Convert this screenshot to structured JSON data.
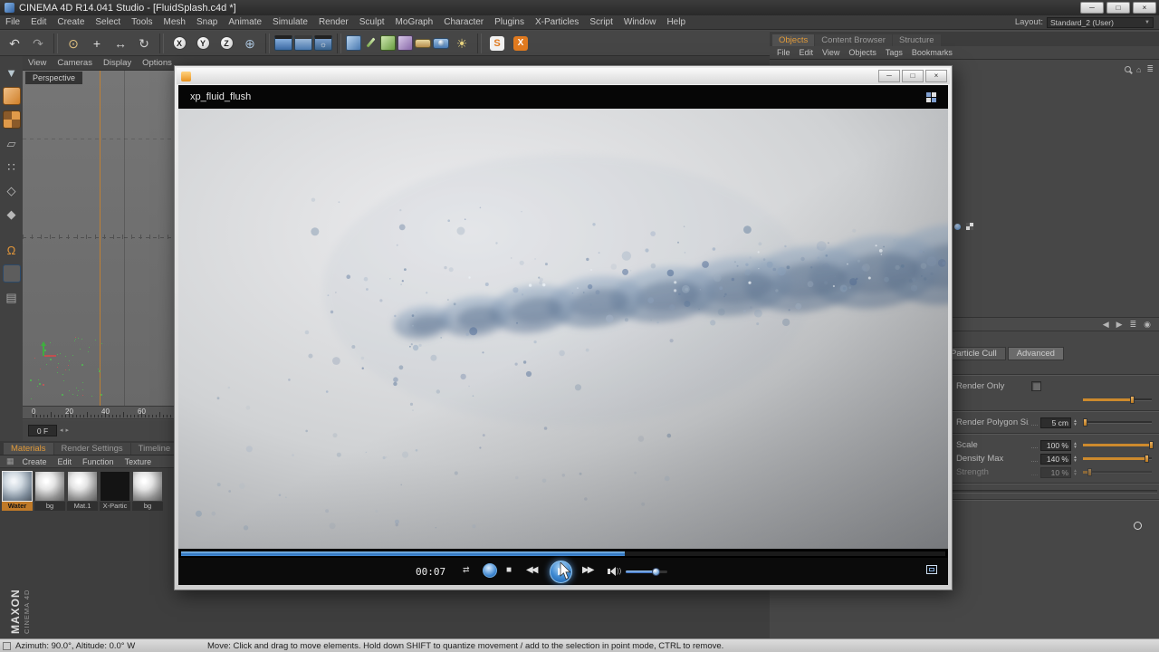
{
  "titlebar": {
    "title": "CINEMA 4D R14.041 Studio - [FluidSplash.c4d *]",
    "minimize": "─",
    "maximize": "□",
    "close": "×"
  },
  "menubar": {
    "items": [
      "File",
      "Edit",
      "Create",
      "Select",
      "Tools",
      "Mesh",
      "Snap",
      "Animate",
      "Simulate",
      "Render",
      "Sculpt",
      "MoGraph",
      "Character",
      "Plugins",
      "X-Particles",
      "Script",
      "Window",
      "Help"
    ],
    "layout_label": "Layout:",
    "layout_value": "Standard_2 (User)",
    "layout_arrow": "▼"
  },
  "toolbar": {
    "icons": [
      {
        "name": "undo-icon",
        "glyph": "↶",
        "color": "#d8d8d8"
      },
      {
        "name": "redo-icon",
        "glyph": "↷",
        "color": "#9a9a9a"
      },
      {
        "sep": true
      },
      {
        "name": "live-selection-icon",
        "glyph": "⊙",
        "color": "#e0c080"
      },
      {
        "name": "move-tool-icon",
        "glyph": "+",
        "color": "#e0e0e0"
      },
      {
        "name": "scale-tool-icon",
        "glyph": "↔",
        "color": "#d0d0d0"
      },
      {
        "name": "rotate-tool-icon",
        "glyph": "↻",
        "color": "#d0d0d0"
      },
      {
        "sep": true
      },
      {
        "name": "x-axis-button",
        "letter": "X"
      },
      {
        "name": "y-axis-button",
        "letter": "Y"
      },
      {
        "name": "z-axis-button",
        "letter": "Z"
      },
      {
        "name": "coordinate-system-icon",
        "glyph": "⊕",
        "color": "#a8c0d8"
      },
      {
        "sep": true
      },
      {
        "name": "render-view-icon",
        "style": "st-render"
      },
      {
        "name": "render-picture-viewer-icon",
        "style": "st-render2"
      },
      {
        "name": "render-settings-icon",
        "style": "st-render3"
      },
      {
        "sep": true
      },
      {
        "name": "cube-primitive-icon",
        "style": "st-cube-blue"
      },
      {
        "name": "spline-pen-icon",
        "style": "st-pen"
      },
      {
        "name": "generators-icon",
        "style": "st-cube-green"
      },
      {
        "name": "deformers-icon",
        "style": "st-cube-purple"
      },
      {
        "name": "floor-icon",
        "style": "st-floor"
      },
      {
        "name": "camera-icon",
        "style": "st-camera"
      },
      {
        "name": "light-icon",
        "glyph": "☀",
        "color": "#e8d47f"
      },
      {
        "sep": true
      },
      {
        "name": "sketchfab-icon",
        "letter": "S",
        "style": "st-badge-white"
      },
      {
        "name": "xparticles-icon",
        "letter": "X",
        "style": "st-badge-orange"
      }
    ]
  },
  "left_toolbar": {
    "icons": [
      {
        "name": "make-editable-icon",
        "glyph": "▼",
        "color": "#b8c8d0"
      },
      {
        "name": "model-mode-icon",
        "style": "st-cube-orange"
      },
      {
        "name": "texture-mode-icon",
        "style": "st-checker-orange"
      },
      {
        "name": "workplane-mode-icon",
        "glyph": "▱",
        "color": "#b0b0b0"
      },
      {
        "name": "points-mode-icon",
        "glyph": "∷",
        "color": "#c8c8c8"
      },
      {
        "name": "edges-mode-icon",
        "glyph": "◇",
        "color": "#c0c0c0"
      },
      {
        "name": "polygons-mode-icon",
        "glyph": "◆",
        "color": "#b8b8b8"
      },
      {
        "name": "snap-icon",
        "glyph": "Ω",
        "color": "#e0953a",
        "gap": true
      },
      {
        "name": "viewport-filter-icon",
        "style": "st-cube-blue",
        "selected": true
      },
      {
        "name": "layer-manager-icon",
        "glyph": "▤",
        "color": "#a8a8a8"
      }
    ]
  },
  "viewport": {
    "menu": [
      "View",
      "Cameras",
      "Display",
      "Options"
    ],
    "camera_label": "Perspective"
  },
  "ruler": {
    "labels": [
      "0",
      "20",
      "40",
      "60"
    ],
    "frame_field": "0 F",
    "spin_left": "◂",
    "spin_right": "▸"
  },
  "materials": {
    "tabs": [
      "Materials",
      "Render Settings",
      "Timeline"
    ],
    "active_tab": "Materials",
    "menu_icon": "▦",
    "menu": [
      "Create",
      "Edit",
      "Function",
      "Texture"
    ],
    "items": [
      {
        "label": "Water",
        "type": "water",
        "selected": true
      },
      {
        "label": "bg",
        "type": "sphere"
      },
      {
        "label": "Mat.1",
        "type": "sphere"
      },
      {
        "label": "X-Partic",
        "type": "dark"
      },
      {
        "label": "bg",
        "type": "sphere"
      }
    ]
  },
  "object_manager": {
    "tabs": [
      "Objects",
      "Content Browser",
      "Structure"
    ],
    "active_tab": "Objects",
    "menu": [
      "File",
      "Edit",
      "View",
      "Objects",
      "Tags",
      "Bookmarks"
    ],
    "mini_icons": [
      {
        "name": "search-icon",
        "style": "mag"
      },
      {
        "name": "home-icon",
        "glyph": "⌂"
      },
      {
        "name": "filter-icon",
        "glyph": "≣"
      }
    ]
  },
  "attribute_manager": {
    "tabs": [
      "Particle Cull",
      "Advanced"
    ],
    "active_tab": "Advanced",
    "header_icons": [
      {
        "name": "history-back-icon",
        "glyph": "◀"
      },
      {
        "name": "history-forward-icon",
        "glyph": "▶"
      },
      {
        "name": "list-icon",
        "glyph": "≣"
      },
      {
        "name": "lock-icon",
        "glyph": "◉"
      }
    ],
    "rows": [
      {
        "type": "spacer"
      },
      {
        "type": "sep"
      },
      {
        "label": "Render Only",
        "control": "checkbox",
        "checked": false
      },
      {
        "label": "",
        "control": "slider",
        "fill": 72
      },
      {
        "type": "sep"
      },
      {
        "label": "Render Polygon Size",
        "value": "5 cm",
        "control": "value",
        "fill": 4
      },
      {
        "type": "sep"
      },
      {
        "label": "Scale",
        "value": "100 %",
        "control": "value",
        "fill": 100
      },
      {
        "label": "Density Max",
        "value": "140 %",
        "control": "value",
        "fill": 93
      },
      {
        "label": "Strength",
        "value": "10 %",
        "control": "value",
        "fill": 10,
        "disabled": true
      },
      {
        "type": "sep"
      },
      {
        "type": "groove"
      },
      {
        "type": "sep"
      }
    ]
  },
  "player": {
    "clip_title": "xp_fluid_flush",
    "time": "00:07",
    "progress_pct": 58,
    "volume_pct": 70,
    "icons": {
      "loop": "⇄",
      "stop": "■",
      "rew": "◀◀",
      "play": "▶",
      "ff": "▶▶",
      "waves": "))"
    },
    "window_buttons": {
      "minimize": "─",
      "maximize": "□",
      "close": "×"
    }
  },
  "statusbar": {
    "coords": "Azimuth: 90.0°, Altitude: 0.0°   W",
    "hint": "Move: Click and drag to move elements. Hold down SHIFT to quantize movement / add to the selection in point mode, CTRL to remove."
  },
  "branding": {
    "maxon": "MAXON",
    "cinema": "CINEMA 4D"
  }
}
